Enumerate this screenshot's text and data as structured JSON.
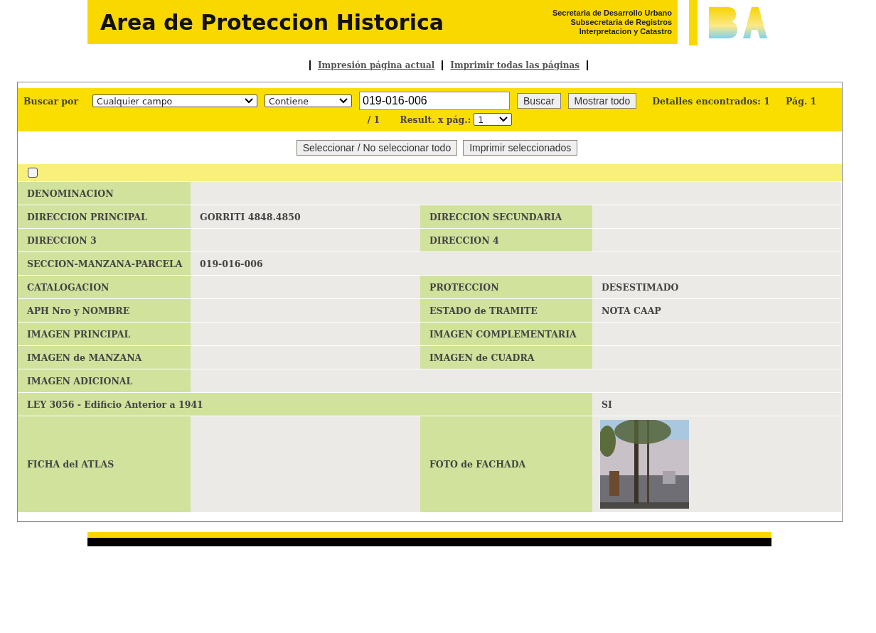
{
  "header": {
    "title": "Area de Proteccion Historica",
    "agency": [
      "Secretaria de Desarrollo Urbano",
      "Subsecretaria de Registros",
      "Interpretacion y Catastro"
    ]
  },
  "print_links": [
    "Impresión página actual",
    "Imprimir todas las páginas"
  ],
  "search": {
    "label": "Buscar por",
    "field": "Cualquier campo",
    "operator": "Contiene",
    "value": "019-016-006",
    "buttons": [
      "Buscar",
      "Mostrar todo"
    ],
    "found": "Detalles encontrados: 1",
    "page": "Pág. 1",
    "page_total": "/ 1",
    "per_page_label": "Result. x pág.:",
    "per_page": "1"
  },
  "actions": [
    "Seleccionar / No seleccionar todo",
    "Imprimir seleccionados"
  ],
  "select_all": {
    "checked": false
  },
  "rows": [
    {
      "kind": "single",
      "cells": [
        {
          "label": "DENOMINACION"
        }
      ]
    },
    {
      "kind": "pair",
      "cells": [
        {
          "label": "DIRECCION PRINCIPAL",
          "value": "GORRITI 4848.4850"
        },
        {
          "label": "DIRECCION SECUNDARIA"
        }
      ]
    },
    {
      "kind": "pair",
      "cells": [
        {
          "label": "DIRECCION 3"
        },
        {
          "label": "DIRECCION 4"
        }
      ]
    },
    {
      "kind": "single",
      "cells": [
        {
          "label": "SECCION-MANZANA-PARCELA",
          "value": "019-016-006"
        }
      ]
    },
    {
      "kind": "pair",
      "cells": [
        {
          "label": "CATALOGACION"
        },
        {
          "label": "PROTECCION",
          "value": "DESESTIMADO"
        }
      ]
    },
    {
      "kind": "pair",
      "cells": [
        {
          "label": "APH Nro y NOMBRE"
        },
        {
          "label": "ESTADO de TRAMITE",
          "value": "NOTA CAAP"
        }
      ]
    },
    {
      "kind": "pair",
      "cells": [
        {
          "label": "IMAGEN PRINCIPAL"
        },
        {
          "label": "IMAGEN COMPLEMENTARIA"
        }
      ]
    },
    {
      "kind": "pair",
      "cells": [
        {
          "label": "IMAGEN de MANZANA"
        },
        {
          "label": "IMAGEN de CUADRA"
        }
      ]
    },
    {
      "kind": "single",
      "cells": [
        {
          "label": "IMAGEN ADICIONAL"
        }
      ]
    },
    {
      "kind": "wide",
      "cells": [
        {
          "label": "LEY 3056 - Edificio Anterior a 1941",
          "value": "SI"
        }
      ]
    },
    {
      "cells": [
        {
          "label": "FICHA del ATLAS"
        },
        {
          "label": "FOTO de FACHADA"
        }
      ]
    }
  ]
}
